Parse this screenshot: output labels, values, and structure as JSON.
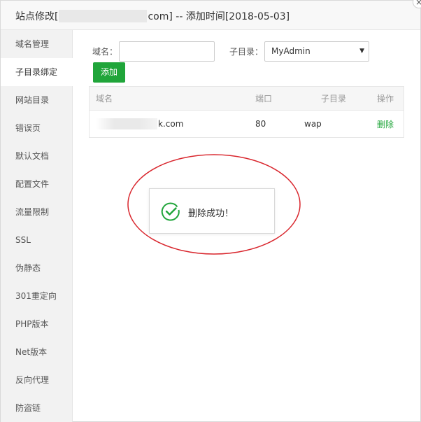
{
  "title": {
    "prefix": "站点修改[",
    "suffix": "com] -- 添加时间[2018-05-03]",
    "close_glyph": "×"
  },
  "sidebar": {
    "items": [
      {
        "label": "域名管理"
      },
      {
        "label": "子目录绑定"
      },
      {
        "label": "网站目录"
      },
      {
        "label": "错误页"
      },
      {
        "label": "默认文档"
      },
      {
        "label": "配置文件"
      },
      {
        "label": "流量限制"
      },
      {
        "label": "SSL"
      },
      {
        "label": "伪静态"
      },
      {
        "label": "301重定向"
      },
      {
        "label": "PHP版本"
      },
      {
        "label": "Net版本"
      },
      {
        "label": "反向代理"
      },
      {
        "label": "防盗链"
      }
    ],
    "active_index": 1
  },
  "form": {
    "domain_label": "域名：",
    "domain_value": "",
    "domain_placeholder": "",
    "subdir_label": "子目录：",
    "subdir_selected": "MyAdmin",
    "add_button_label": "添加"
  },
  "table": {
    "columns": [
      "域名",
      "端口",
      "子目录",
      "操作"
    ],
    "rows": [
      {
        "domain_visible": "k.com",
        "port": "80",
        "subdir": "wap",
        "action": "删除"
      }
    ]
  },
  "toast": {
    "message": "删除成功！",
    "icon": "check-circle-icon"
  },
  "colors": {
    "accent_green": "#20a53a",
    "annotation_red": "#d9272e"
  }
}
